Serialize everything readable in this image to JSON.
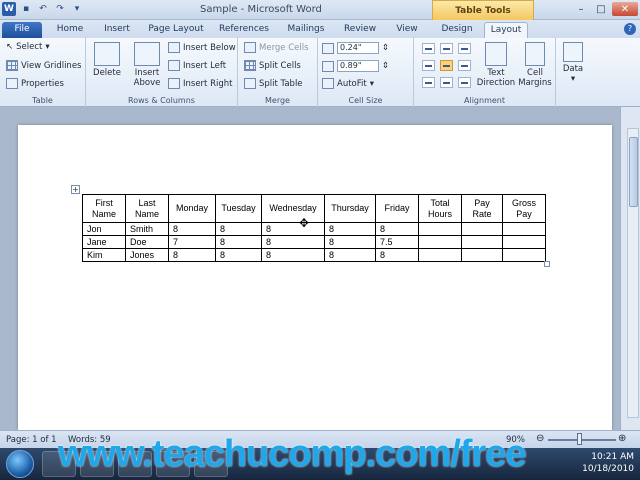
{
  "window": {
    "title": "Sample - Microsoft Word",
    "contextual_tab": "Table Tools"
  },
  "tabs": [
    {
      "label": "File"
    },
    {
      "label": "Home"
    },
    {
      "label": "Insert"
    },
    {
      "label": "Page Layout"
    },
    {
      "label": "References"
    },
    {
      "label": "Mailings"
    },
    {
      "label": "Review"
    },
    {
      "label": "View"
    },
    {
      "label": "Design"
    },
    {
      "label": "Layout"
    }
  ],
  "ribbon": {
    "table": {
      "select": "Select",
      "gridlines": "View Gridlines",
      "properties": "Properties",
      "label": "Table"
    },
    "rows_columns": {
      "delete": "Delete",
      "insert_above": "Insert Above",
      "insert_below": "Insert Below",
      "insert_left": "Insert Left",
      "insert_right": "Insert Right",
      "label": "Rows & Columns"
    },
    "merge": {
      "merge_cells": "Merge Cells",
      "split_cells": "Split Cells",
      "split_table": "Split Table",
      "label": "Merge"
    },
    "cell_size": {
      "height": "0.24\"",
      "width": "0.89\"",
      "autofit": "AutoFit",
      "label": "Cell Size"
    },
    "alignment": {
      "text_direction": "Text Direction",
      "cell_margins": "Cell Margins",
      "label": "Alignment"
    },
    "data": {
      "label": "Data"
    }
  },
  "table": {
    "headers": [
      "First Name",
      "Last Name",
      "Monday",
      "Tuesday",
      "Wednesday",
      "Thursday",
      "Friday",
      "Total Hours",
      "Pay Rate",
      "Gross Pay"
    ],
    "rows": [
      [
        "Jon",
        "Smith",
        "8",
        "8",
        "8",
        "8",
        "8",
        "",
        "",
        ""
      ],
      [
        "Jane",
        "Doe",
        "7",
        "8",
        "8",
        "8",
        "7.5",
        "",
        "",
        ""
      ],
      [
        "Kim",
        "Jones",
        "8",
        "8",
        "8",
        "8",
        "8",
        "",
        "",
        ""
      ]
    ]
  },
  "status": {
    "page": "Page: 1 of 1",
    "words": "Words: 59",
    "zoom": "90%"
  },
  "taskbar": {
    "time": "10:21 AM",
    "date": "10/18/2010"
  },
  "watermark": "www.teachucomp.com/free",
  "colors": {
    "file_tab": "#1e4f9a",
    "contextual": "#f4c760",
    "watermark": "#1ea7ea"
  }
}
